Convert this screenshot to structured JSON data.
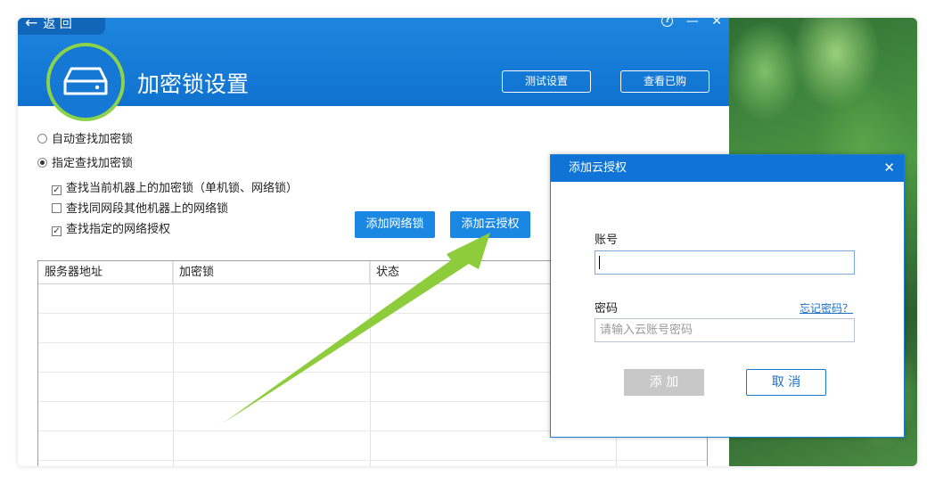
{
  "header": {
    "back_label": "返 回",
    "title": "加密锁设置",
    "test_button": "测试设置",
    "view_button": "查看已购",
    "help_icon": "question-icon",
    "minimize_icon": "minimize-icon",
    "close_icon": "close-icon"
  },
  "options": {
    "auto_find": "自动查找加密锁",
    "specify_find": "指定查找加密锁",
    "check_local": "查找当前机器上的加密锁（单机锁、网络锁）",
    "check_same_segment": "查找同网段其他机器上的网络锁",
    "check_specified_auth": "查找指定的网络授权",
    "auto_find_selected": false,
    "specify_find_selected": true,
    "check_local_checked": true,
    "check_same_segment_checked": false,
    "check_specified_auth_checked": true
  },
  "buttons": {
    "add_network_lock": "添加网络锁",
    "add_cloud_auth": "添加云授权"
  },
  "table": {
    "columns": [
      "服务器地址",
      "加密锁",
      "状态",
      ""
    ],
    "rows": []
  },
  "dialog": {
    "title": "添加云授权",
    "account_label": "账号",
    "account_value": "",
    "password_label": "密码",
    "password_placeholder": "请输入云账号密码",
    "forgot_link": "忘记密码？",
    "add_button": "添 加",
    "cancel_button": "取 消"
  },
  "colors": {
    "header_blue": "#1478d4",
    "accent_green": "#8cd24a",
    "arrow_green": "#8dcc3a"
  }
}
